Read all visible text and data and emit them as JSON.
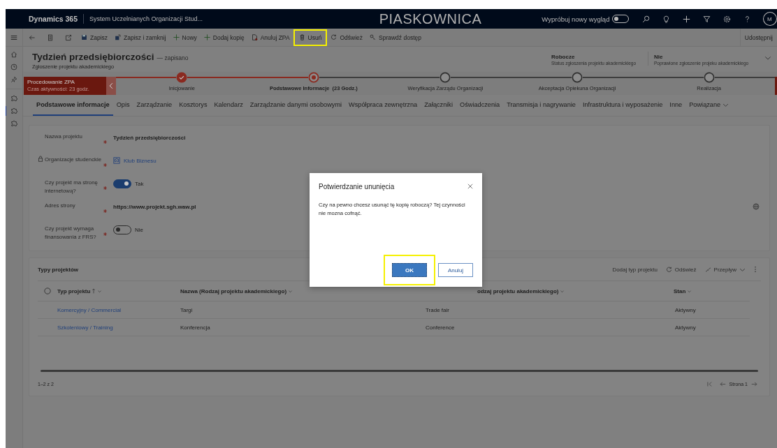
{
  "top_bar": {
    "app_name": "Dynamics 365",
    "app_title": "System Uczelnianych Organizacji Stud...",
    "environment": "PIASKOWNICA",
    "try_new_look": {
      "label": "Wypróbuj nowy wygląd",
      "on": false
    },
    "avatar_initials": "M"
  },
  "command_bar": {
    "items": [
      {
        "label": "Zapisz",
        "kind": "save",
        "highlighted": false
      },
      {
        "label": "Zapisz i zamknij",
        "kind": "save-close",
        "highlighted": false
      },
      {
        "label": "Nowy",
        "kind": "add",
        "highlighted": false
      },
      {
        "label": "Dodaj kopię",
        "kind": "add",
        "highlighted": false
      },
      {
        "label": "Anuluj ZPA",
        "kind": "cancel",
        "highlighted": false
      },
      {
        "label": "Usuń",
        "kind": "delete",
        "highlighted": true
      },
      {
        "label": "Odśwież",
        "kind": "refresh",
        "highlighted": false
      },
      {
        "label": "Sprawdź dostęp",
        "kind": "access",
        "highlighted": false
      }
    ],
    "share": "Udostępnij"
  },
  "header": {
    "title": "Tydzień przedsiębiorczości",
    "save_status": "— zapisano",
    "subtitle": "Zgłoszenie projektu akademickiego",
    "fields": [
      {
        "value": "Robocze",
        "label": "Status zgłoszenia projektu akademickiego"
      },
      {
        "value": "Nie",
        "label": "Poprawione zgłoszenie projeku akademickiego"
      }
    ]
  },
  "process": {
    "active_stage": {
      "name": "Procedowanie ZPA",
      "time": "Czas aktywności: 23 godz."
    },
    "stages": [
      {
        "name": "Inicjowanie",
        "kind": "done"
      },
      {
        "name": "Podstawowe Informacje  (23 Godz.)",
        "kind": "current"
      },
      {
        "name": "Weryfikacja Zarządu Organizacji",
        "kind": "pending"
      },
      {
        "name": "Akceptacja Opiekuna Organizacji",
        "kind": "pending"
      },
      {
        "name": "Realizacja",
        "kind": "pending"
      }
    ]
  },
  "tabs": [
    {
      "label": "Podstawowe informacje",
      "selected": true,
      "dropdown": false
    },
    {
      "label": "Opis",
      "selected": false,
      "dropdown": false
    },
    {
      "label": "Zarządzanie",
      "selected": false,
      "dropdown": false
    },
    {
      "label": "Kosztorys",
      "selected": false,
      "dropdown": false
    },
    {
      "label": "Kalendarz",
      "selected": false,
      "dropdown": false
    },
    {
      "label": "Zarządzanie danymi osobowymi",
      "selected": false,
      "dropdown": false
    },
    {
      "label": "Współpraca zewnętrzna",
      "selected": false,
      "dropdown": false
    },
    {
      "label": "Załączniki",
      "selected": false,
      "dropdown": false
    },
    {
      "label": "Oświadczenia",
      "selected": false,
      "dropdown": false
    },
    {
      "label": "Transmisja i nagrywanie",
      "selected": false,
      "dropdown": false
    },
    {
      "label": "Infrastruktura i wyposażenie",
      "selected": false,
      "dropdown": false
    },
    {
      "label": "Inne",
      "selected": false,
      "dropdown": false
    },
    {
      "label": "Powiązane",
      "selected": false,
      "dropdown": true
    }
  ],
  "form": {
    "fields": [
      {
        "label": "Nazwa projektu",
        "required": true,
        "locked": false,
        "kind": "text",
        "value": "Tydzień przedsiębiorczości"
      },
      {
        "label": "Organizacje studenckie",
        "required": true,
        "locked": true,
        "kind": "lookup",
        "value": "Klub Biznesu"
      },
      {
        "label": "Czy projekt ma stronę internetową?",
        "required": true,
        "locked": false,
        "kind": "toggle",
        "on": true,
        "value": "Tak"
      },
      {
        "label": "Adres strony",
        "required": true,
        "locked": false,
        "kind": "url",
        "value": "https://www.projekt.sgh.waw.pl"
      },
      {
        "label": "Czy projekt wymaga finansowania z FRS?",
        "required": true,
        "locked": false,
        "kind": "toggle",
        "on": false,
        "value": "Nie"
      }
    ]
  },
  "subgrid": {
    "title": "Typy projektów",
    "actions": [
      {
        "label": "Dodaj typ projektu",
        "kind": "plain"
      },
      {
        "label": "Odśwież",
        "kind": "refresh"
      },
      {
        "label": "Przepływ",
        "kind": "flow"
      }
    ],
    "all_selected": false,
    "columns": [
      {
        "label": "Typ projektu",
        "sorted": true
      },
      {
        "label": "Nazwa (Rodzaj projektu akademickiego)",
        "sorted": false
      },
      {
        "label": "odzaj projektu akademickiego)",
        "sorted": false
      },
      {
        "label": "Stan",
        "sorted": false
      }
    ],
    "rows": [
      {
        "cells": [
          "Komercyjny / Commercial",
          "Targi",
          "Trade fair",
          "Aktywny"
        ]
      },
      {
        "cells": [
          "Szkoleniowy / Training",
          "Konferencja",
          "Conference",
          "Aktywny"
        ]
      }
    ],
    "record_count": "1–2 z 2",
    "page": "Strona 1"
  },
  "dialog": {
    "title": "Potwierdzanie ununięcia",
    "message": "Czy na pewno chcesz usunąć tę kopię roboczą? Tej czynności nie mozna cofnąć.",
    "buttons": [
      {
        "label": "OK",
        "primary": true,
        "highlighted": true
      },
      {
        "label": "Anuluj",
        "primary": false,
        "highlighted": false
      }
    ]
  }
}
